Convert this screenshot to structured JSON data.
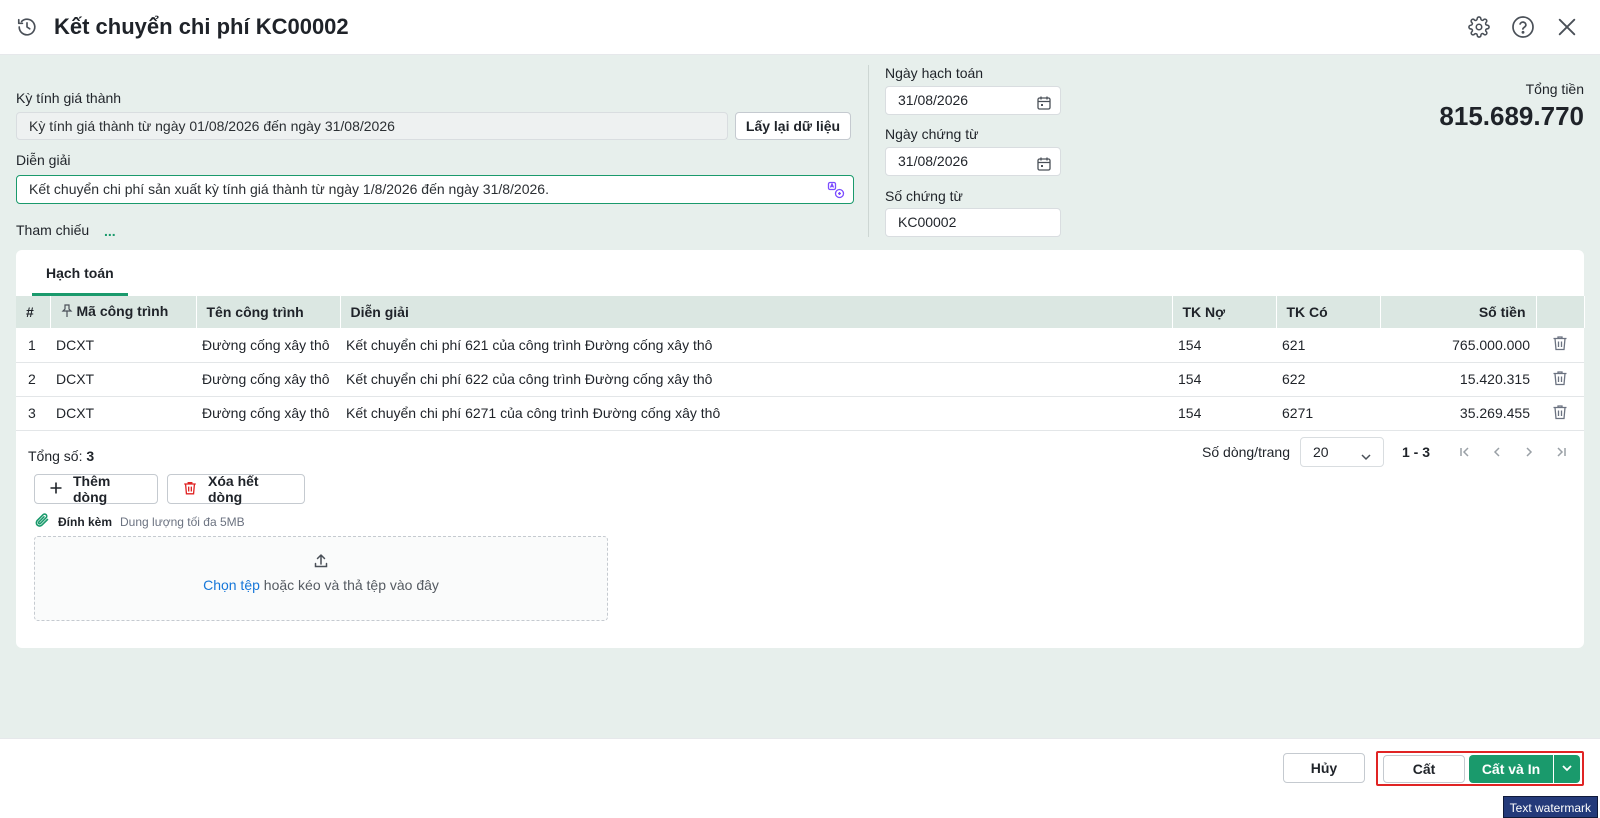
{
  "header": {
    "title": "Kết chuyển chi phí KC00002"
  },
  "form": {
    "period_label": "Kỳ tính giá thành",
    "period_value": "Kỳ tính giá thành từ ngày 01/08/2026 đến ngày 31/08/2026",
    "reload_button": "Lấy lại dữ liệu",
    "description_label": "Diễn giải",
    "description_value": "Kết chuyển chi phí sản xuất kỳ tính giá thành từ ngày 1/8/2026 đến ngày 31/8/2026.",
    "reference_label": "Tham chiếu",
    "reference_more": "...",
    "posting_date_label": "Ngày hạch toán",
    "posting_date_value": "31/08/2026",
    "voucher_date_label": "Ngày chứng từ",
    "voucher_date_value": "31/08/2026",
    "voucher_no_label": "Số chứng từ",
    "voucher_no_value": "KC00002",
    "total_label": "Tổng tiền",
    "total_value": "815.689.770"
  },
  "tabs": [
    {
      "label": "Hạch toán",
      "active": true
    }
  ],
  "table": {
    "columns": [
      "#",
      "Mã công trình",
      "Tên công trình",
      "Diễn giải",
      "TK Nợ",
      "TK Có",
      "Số tiền"
    ],
    "rows": [
      {
        "no": "1",
        "code": "DCXT",
        "name": "Đường cống xây thô",
        "desc": "Kết chuyển chi phí 621 của công trình Đường cống xây thô",
        "debit": "154",
        "credit": "621",
        "amount": "765.000.000"
      },
      {
        "no": "2",
        "code": "DCXT",
        "name": "Đường cống xây thô",
        "desc": "Kết chuyển chi phí 622 của công trình Đường cống xây thô",
        "debit": "154",
        "credit": "622",
        "amount": "15.420.315"
      },
      {
        "no": "3",
        "code": "DCXT",
        "name": "Đường cống xây thô",
        "desc": "Kết chuyển chi phí 6271 của công trình Đường cống xây thô",
        "debit": "154",
        "credit": "6271",
        "amount": "35.269.455"
      }
    ]
  },
  "summary": {
    "total_count_label": "Tổng số:",
    "total_count_value": "3",
    "page_size_label": "Số dòng/trang",
    "page_size_value": "20",
    "range": "1 - 3"
  },
  "actions": {
    "add_row": "Thêm dòng",
    "delete_all": "Xóa hết dòng"
  },
  "attachment": {
    "label": "Đính kèm",
    "hint": "Dung lượng tối đa 5MB",
    "choose_link": "Chọn tệp",
    "drop_text": " hoặc kéo và thả tệp vào đây"
  },
  "footer": {
    "cancel": "Hủy",
    "save": "Cất",
    "save_print": "Cất và In"
  },
  "watermark": "Text watermark",
  "colors": {
    "accent": "#1a9a6c",
    "background": "#e7efec",
    "highlight_border": "#e02424",
    "link": "#1677d9"
  },
  "icons": {
    "history": "history-icon",
    "settings": "gear-icon",
    "help": "help-icon",
    "close": "close-icon",
    "calendar": "calendar-icon",
    "delete": "trash-icon",
    "pin": "pin-icon",
    "upload": "upload-icon",
    "attach": "paperclip-icon"
  }
}
